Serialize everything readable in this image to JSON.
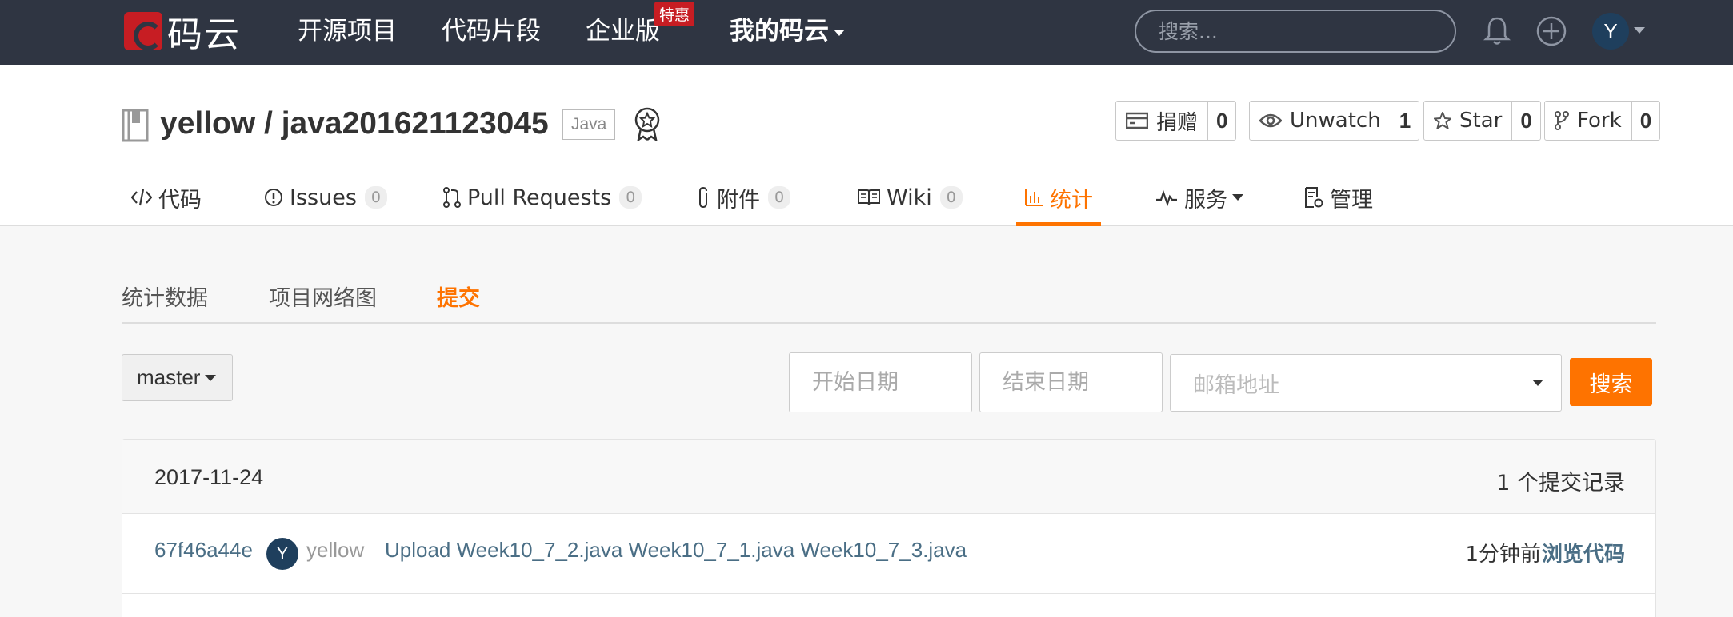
{
  "navbar": {
    "logo_text": "码云",
    "items": [
      "开源项目",
      "代码片段",
      "企业版",
      "我的码云"
    ],
    "hot_badge": "特惠",
    "search_placeholder": "搜索...",
    "avatar_letter": "Y"
  },
  "repo": {
    "title": "yellow / java201621123045",
    "language": "Java",
    "actions": [
      {
        "label": "捐赠",
        "count": "0",
        "icon": "donate-icon"
      },
      {
        "label": "Unwatch",
        "count": "1",
        "icon": "eye-icon"
      },
      {
        "label": "Star",
        "count": "0",
        "icon": "star-icon"
      },
      {
        "label": "Fork",
        "count": "0",
        "icon": "fork-icon"
      }
    ],
    "tabs": [
      {
        "label": "代码",
        "icon": "code-icon"
      },
      {
        "label": "Issues",
        "count": "0",
        "icon": "issue-icon"
      },
      {
        "label": "Pull Requests",
        "count": "0",
        "icon": "pull-request-icon"
      },
      {
        "label": "附件",
        "count": "0",
        "icon": "paperclip-icon"
      },
      {
        "label": "Wiki",
        "count": "0",
        "icon": "book-icon"
      },
      {
        "label": "统计",
        "icon": "bar-chart-icon",
        "active": true
      },
      {
        "label": "服务",
        "icon": "pulse-icon"
      },
      {
        "label": "管理",
        "icon": "settings-doc-icon"
      }
    ]
  },
  "subtabs": [
    "统计数据",
    "项目网络图",
    "提交"
  ],
  "filters": {
    "branch": "master",
    "start_placeholder": "开始日期",
    "end_placeholder": "结束日期",
    "email_placeholder": "邮箱地址",
    "search_label": "搜索"
  },
  "commits": {
    "date": "2017-11-24",
    "count_text": "1 个提交记录",
    "rows": [
      {
        "sha": "67f46a44e",
        "avatar": "Y",
        "author": "yellow",
        "message": "Upload Week10_7_2.java Week10_7_1.java Week10_7_3.java",
        "time": "1分钟前",
        "browse": "浏览代码"
      }
    ]
  },
  "colors": {
    "accent": "#fe7300",
    "navbar": "#2f3542",
    "link": "#4a6e85"
  }
}
